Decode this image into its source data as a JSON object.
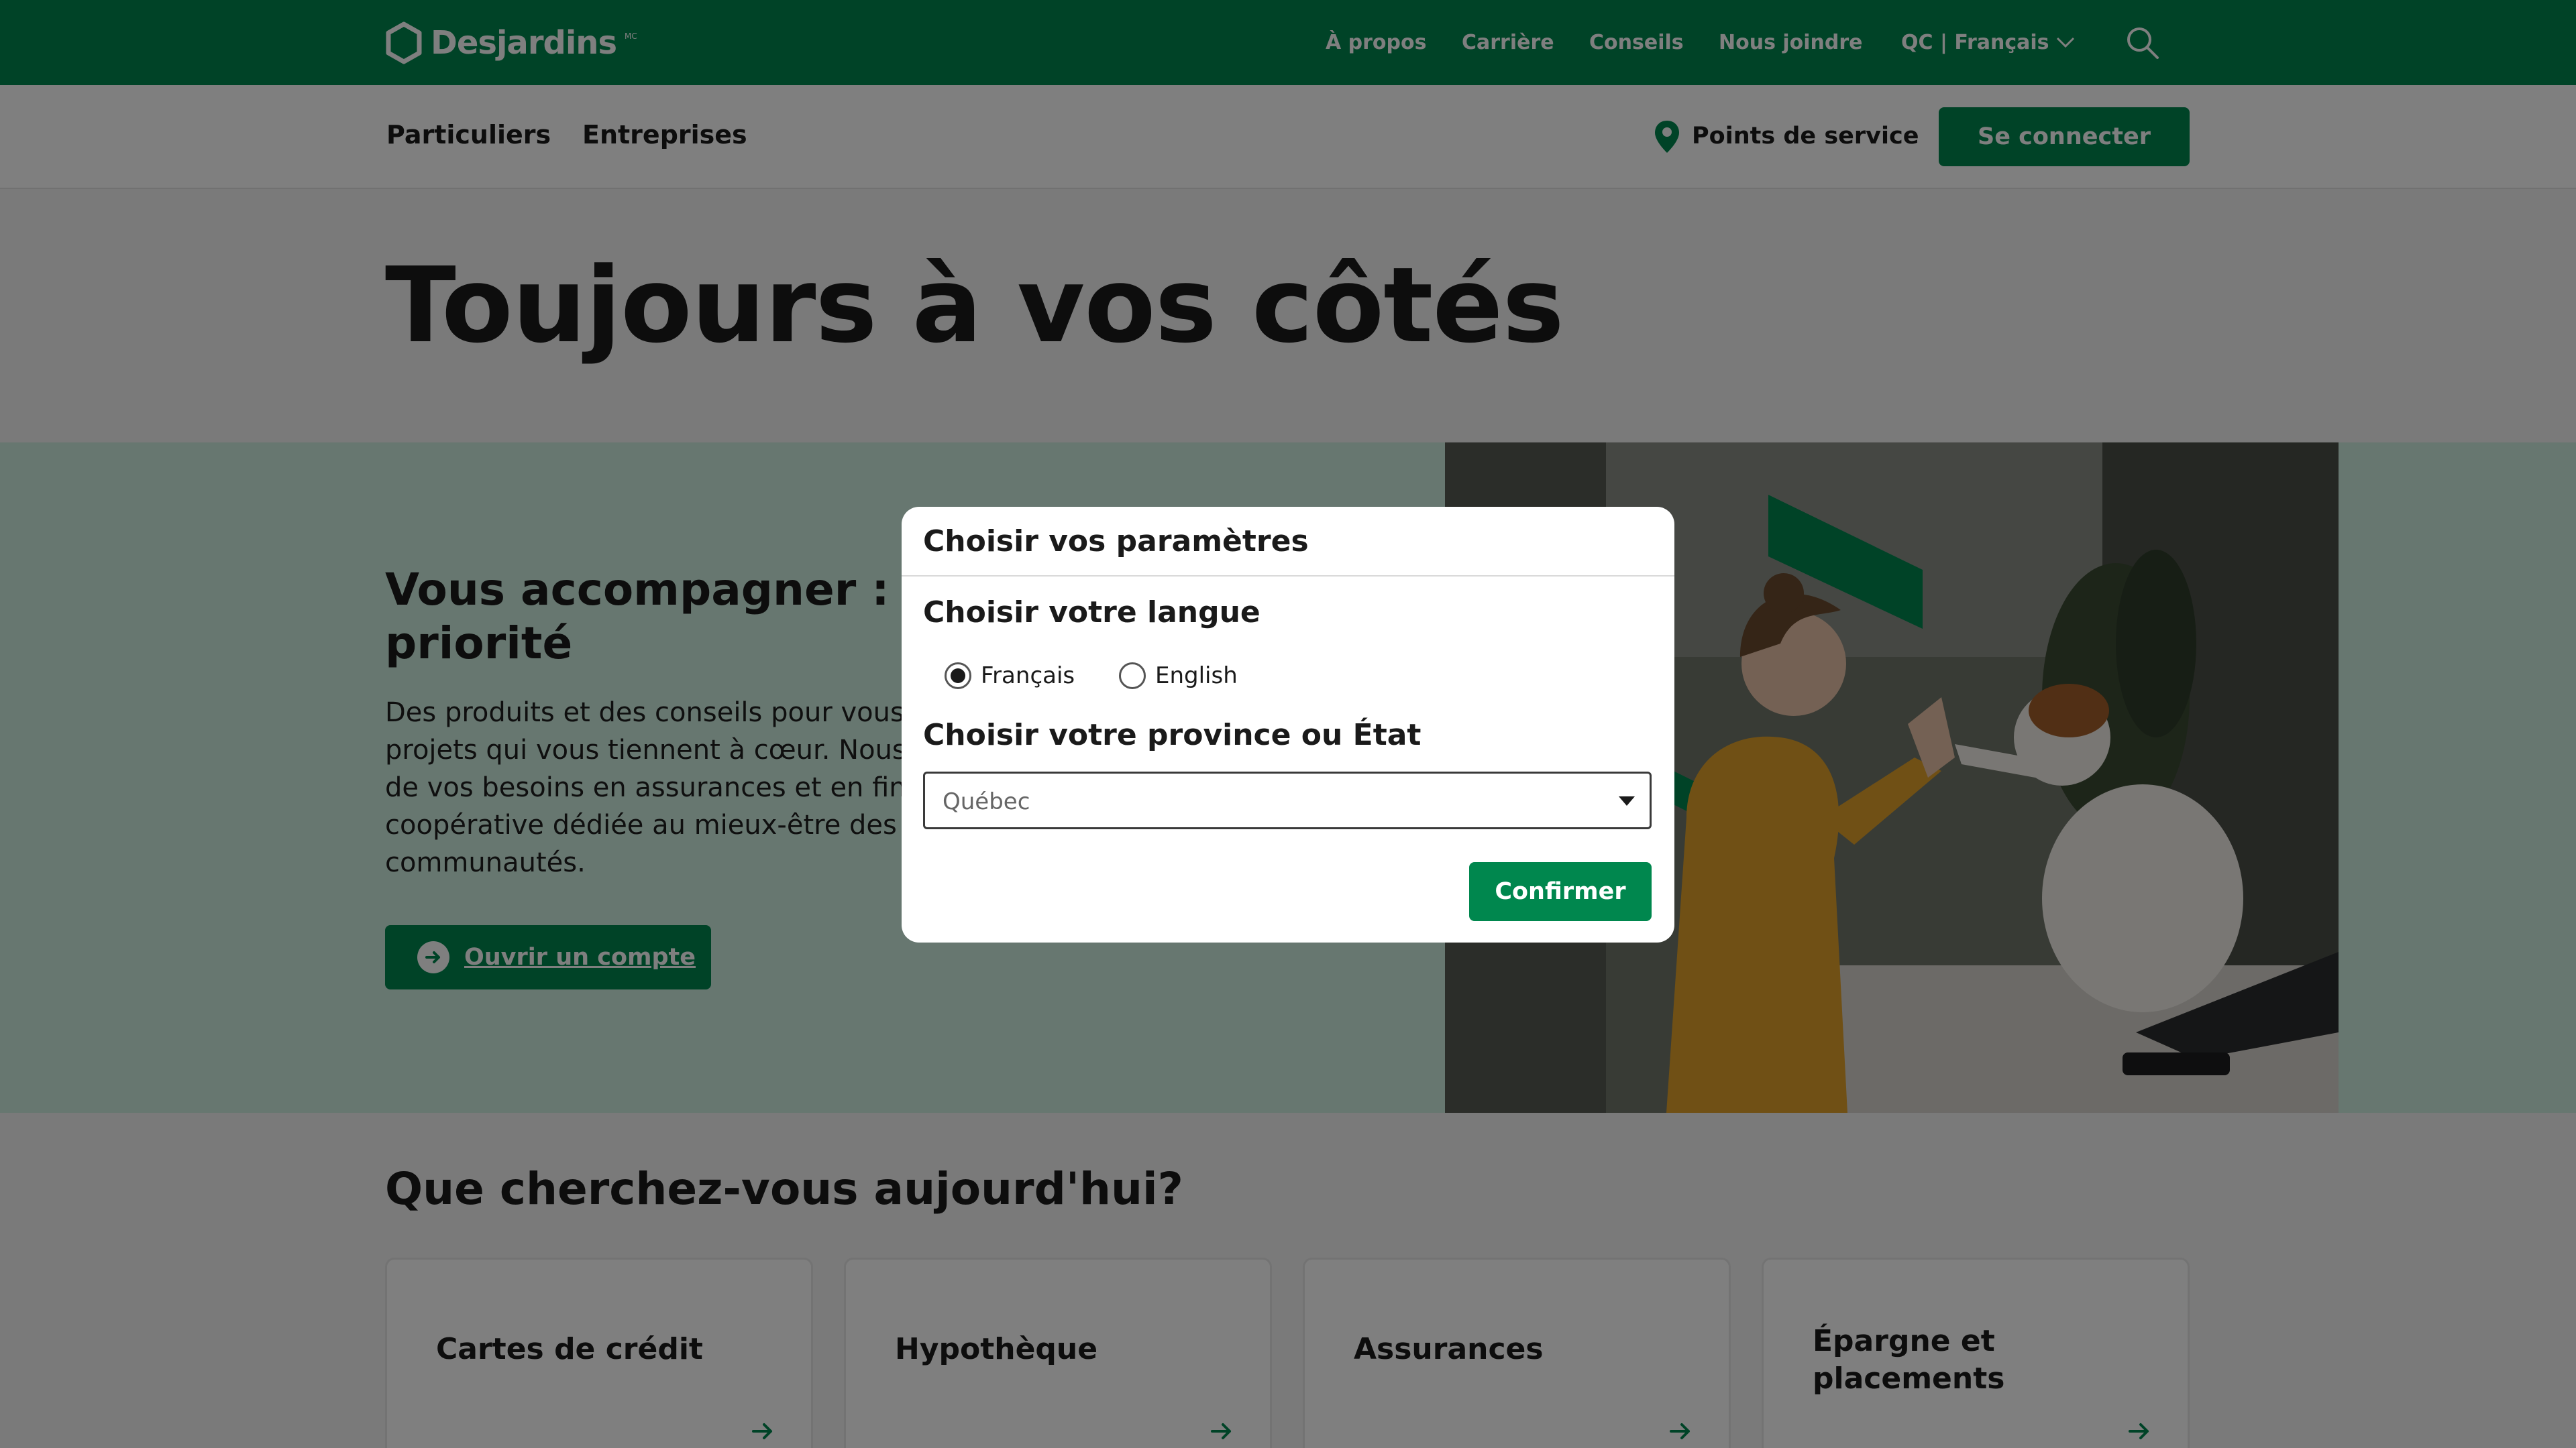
{
  "colors": {
    "brand_green": "#00874e",
    "band_mint": "#cfeee1",
    "text_dark": "#1a1a1a"
  },
  "header": {
    "logo_text": "Desjardins",
    "logo_mark": "MC",
    "utility_nav": [
      "À propos",
      "Carrière",
      "Conseils",
      "Nous joindre"
    ],
    "region_language": "QC | Français",
    "icons": [
      "hexagon-logo-icon",
      "chevron-down-icon",
      "search-icon"
    ]
  },
  "main_nav": {
    "items": [
      "Particuliers",
      "Entreprises"
    ],
    "points_service": "Points de service",
    "login": "Se connecter",
    "icons": [
      "map-pin-icon"
    ]
  },
  "hero": {
    "title": "Toujours à vos côtés"
  },
  "feature": {
    "title_lines": [
      "Vous accompagner : n",
      "priorité"
    ],
    "text_lines": [
      "Des produits et des conseils pour vous",
      "projets qui vous tiennent à cœur. Nous",
      "de vos besoins en assurances et en fin",
      "coopérative dédiée au mieux-être des",
      "communautés."
    ],
    "button_label": "Ouvrir un compte",
    "icons": [
      "arrow-right-circle-icon"
    ]
  },
  "search_section": {
    "title": "Que cherchez-vous aujourd'hui?",
    "cards": [
      {
        "title": "Cartes de crédit"
      },
      {
        "title": "Hypothèque"
      },
      {
        "title": "Assurances"
      },
      {
        "title": "Épargne et placements"
      }
    ]
  },
  "modal": {
    "title": "Choisir vos paramètres",
    "language_title": "Choisir votre langue",
    "languages": [
      {
        "label": "Français",
        "selected": true
      },
      {
        "label": "English",
        "selected": false
      }
    ],
    "province_title": "Choisir votre province ou État",
    "province_value": "Québec",
    "confirm_label": "Confirmer"
  }
}
